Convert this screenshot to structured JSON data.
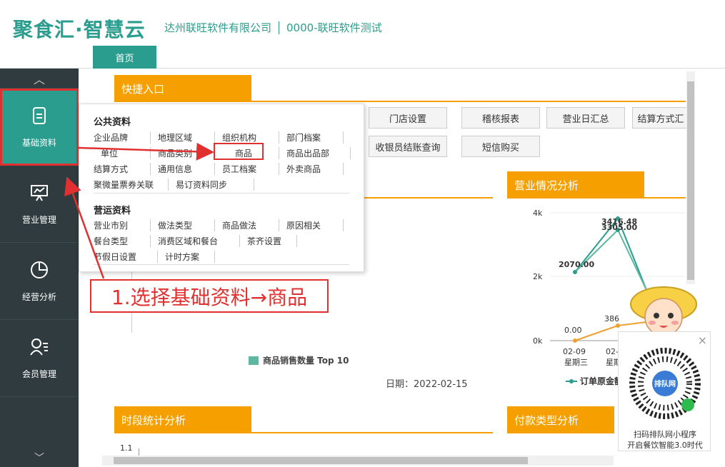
{
  "header": {
    "logo": "聚食汇·智慧云",
    "company": "达州联旺软件有限公司",
    "store": "0000-联旺软件测试",
    "tab_home": "首页"
  },
  "sidebar": {
    "items": [
      {
        "label": "基础资料",
        "icon": "document-icon"
      },
      {
        "label": "营业管理",
        "icon": "presentation-icon"
      },
      {
        "label": "经营分析",
        "icon": "pie-chart-icon"
      },
      {
        "label": "会员管理",
        "icon": "member-icon"
      }
    ]
  },
  "quick": {
    "title": "快捷入口",
    "buttons_row1": [
      "门店设置",
      "稽核报表",
      "营业日汇总",
      "结算方式汇"
    ],
    "buttons_row2": [
      "收银员结账查询",
      "短信购买"
    ]
  },
  "menu": {
    "sec1": "公共资料",
    "row1": [
      "企业品牌",
      "地理区域",
      "组织机构",
      "部门档案"
    ],
    "row2": [
      "单位",
      "商品类别",
      "商品",
      "商品出品部"
    ],
    "row3": [
      "结算方式",
      "通用信息",
      "员工档案",
      "外卖商品"
    ],
    "row4": [
      "聚微量票券关联",
      "易订资料同步"
    ],
    "sec2": "营运资料",
    "row5": [
      "营业市别",
      "做法类型",
      "商品做法",
      "原因相关"
    ],
    "row6": [
      "餐台类型",
      "消费区域和餐台",
      "茶齐设置"
    ],
    "row7": [
      "节假日设置",
      "计时方案"
    ]
  },
  "callout": "1.选择基础资料→商品",
  "top10": {
    "legend": "商品销售数量 Top 10",
    "date": "日期：2022-02-15"
  },
  "biz": {
    "title": "营业情况分析",
    "legend": "订单原金额"
  },
  "chart_data": {
    "type": "line",
    "x": [
      "02-09\n星期三",
      "02-10\n星期四"
    ],
    "yticks": [
      "4k",
      "2k",
      "0k"
    ],
    "series": [
      {
        "name": "订单原金额",
        "values": [
          2070.0,
          3416.48
        ],
        "color": "#2a9d8f"
      },
      {
        "name": "",
        "values": [
          3305.0
        ],
        "color": "#2a9d8f"
      },
      {
        "name": "",
        "values": [
          0.0,
          386
        ],
        "color": "#f0a030"
      }
    ],
    "labels": [
      "2070.00",
      "3416.48",
      "3305.00",
      "0.00",
      "386"
    ]
  },
  "timeseg": {
    "title": "时段统计分析",
    "ytick": "1.1"
  },
  "pay": {
    "title": "付款类型分析"
  },
  "qr": {
    "line1": "扫码排队网小程序",
    "line2": "开启餐饮智能3.0时代",
    "close": "×"
  },
  "colors": {
    "accent": "#2a9d8f",
    "orange": "#f5a000",
    "sidebar": "#2f3b3e",
    "annotation": "#e03030"
  }
}
